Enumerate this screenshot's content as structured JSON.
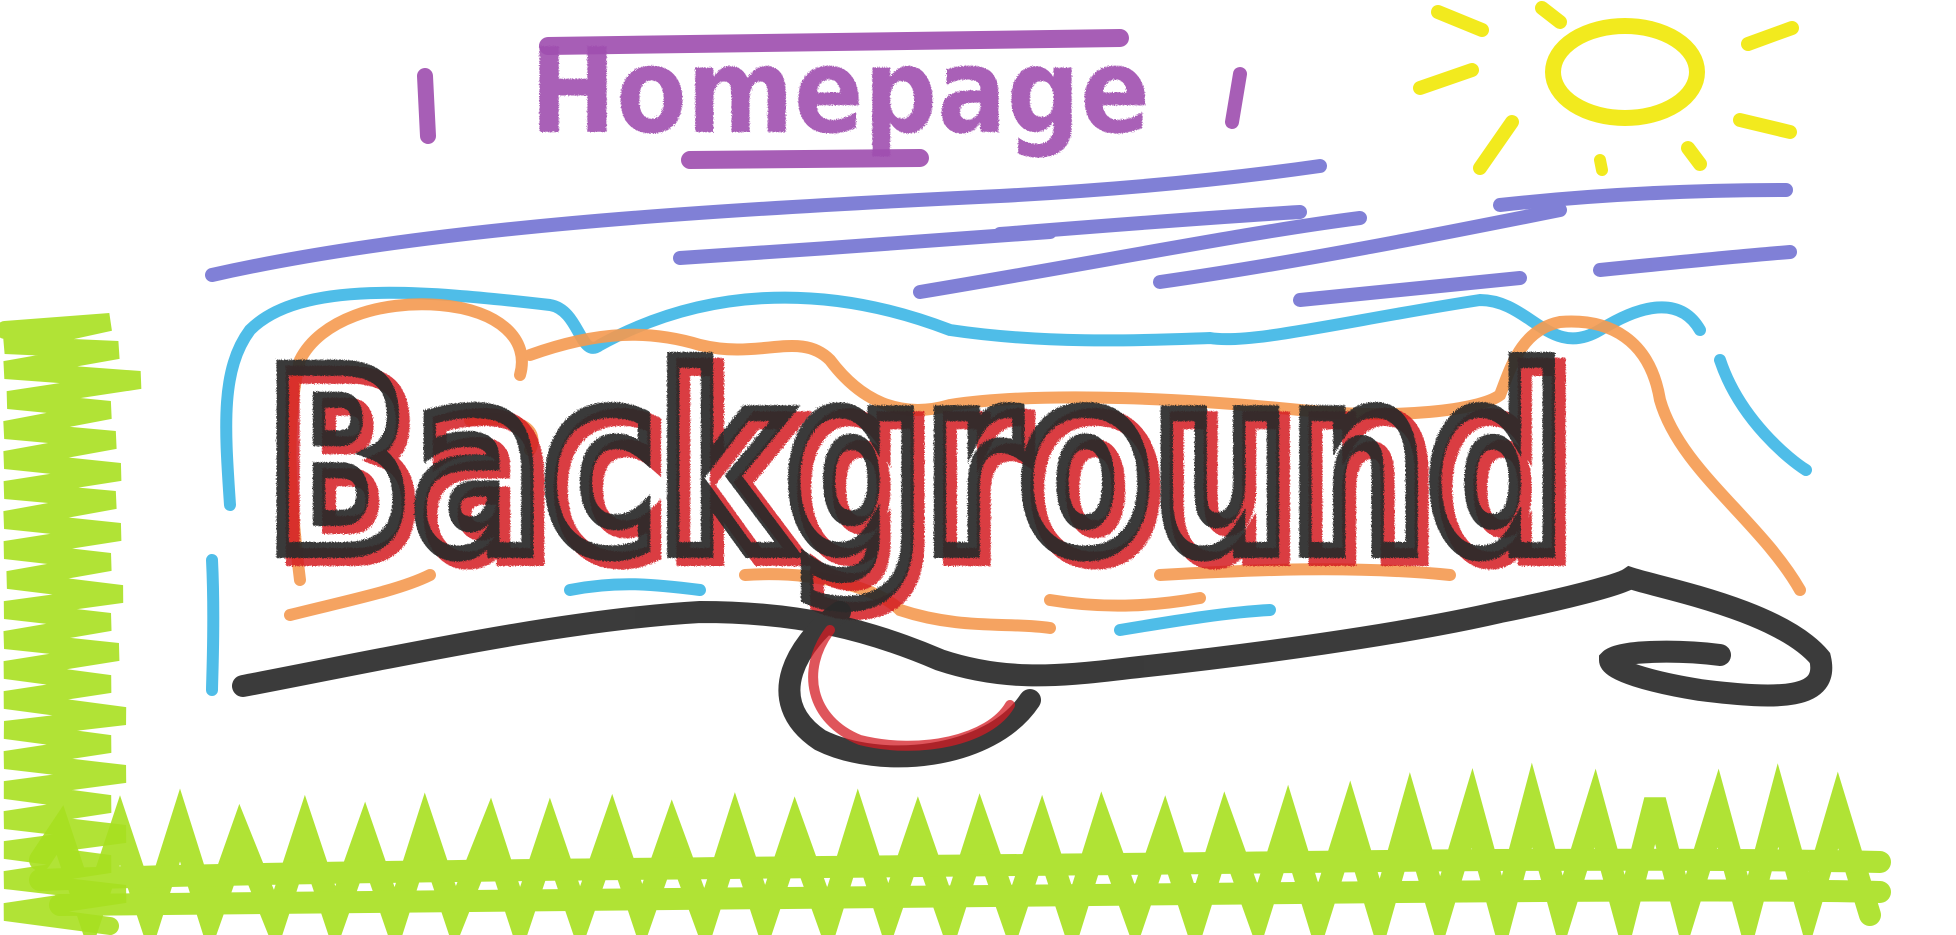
{
  "drawing": {
    "title_text": "Homepage",
    "main_text": "Background"
  },
  "colors": {
    "purple": "#a050b0",
    "violet": "#6a6ad0",
    "sky": "#3cb6e6",
    "orange": "#f59a50",
    "black": "#2a2a2a",
    "red": "#d41c24",
    "lime": "#a8e020",
    "sun": "#f2ea1e"
  }
}
